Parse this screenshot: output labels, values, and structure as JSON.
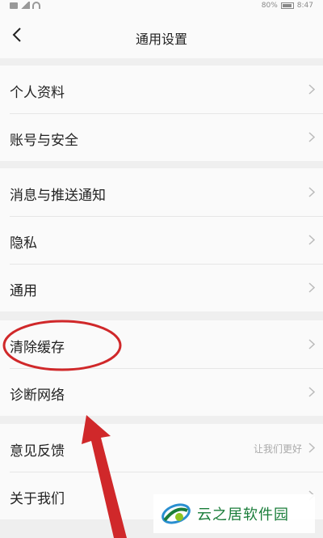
{
  "status_bar": {
    "battery": "80%",
    "time": "8:47"
  },
  "header": {
    "title": "通用设置"
  },
  "groups": [
    {
      "items": [
        {
          "label": "个人资料",
          "hint": ""
        },
        {
          "label": "账号与安全",
          "hint": ""
        }
      ]
    },
    {
      "items": [
        {
          "label": "消息与推送通知",
          "hint": ""
        },
        {
          "label": "隐私",
          "hint": ""
        },
        {
          "label": "通用",
          "hint": ""
        }
      ]
    },
    {
      "items": [
        {
          "label": "清除缓存",
          "hint": ""
        },
        {
          "label": "诊断网络",
          "hint": ""
        }
      ]
    },
    {
      "items": [
        {
          "label": "意见反馈",
          "hint": "让我们更好"
        },
        {
          "label": "关于我们",
          "hint": ""
        }
      ]
    }
  ],
  "annotation": {
    "highlight_color": "#d0282a",
    "arrow_color": "#d0282a"
  },
  "watermark": {
    "text": "云之居软件园",
    "color": "#1a7d3a"
  },
  "colors": {
    "background": "#efefef",
    "surface": "#fafafa",
    "text": "#222222",
    "hint": "#aaaaaa"
  }
}
